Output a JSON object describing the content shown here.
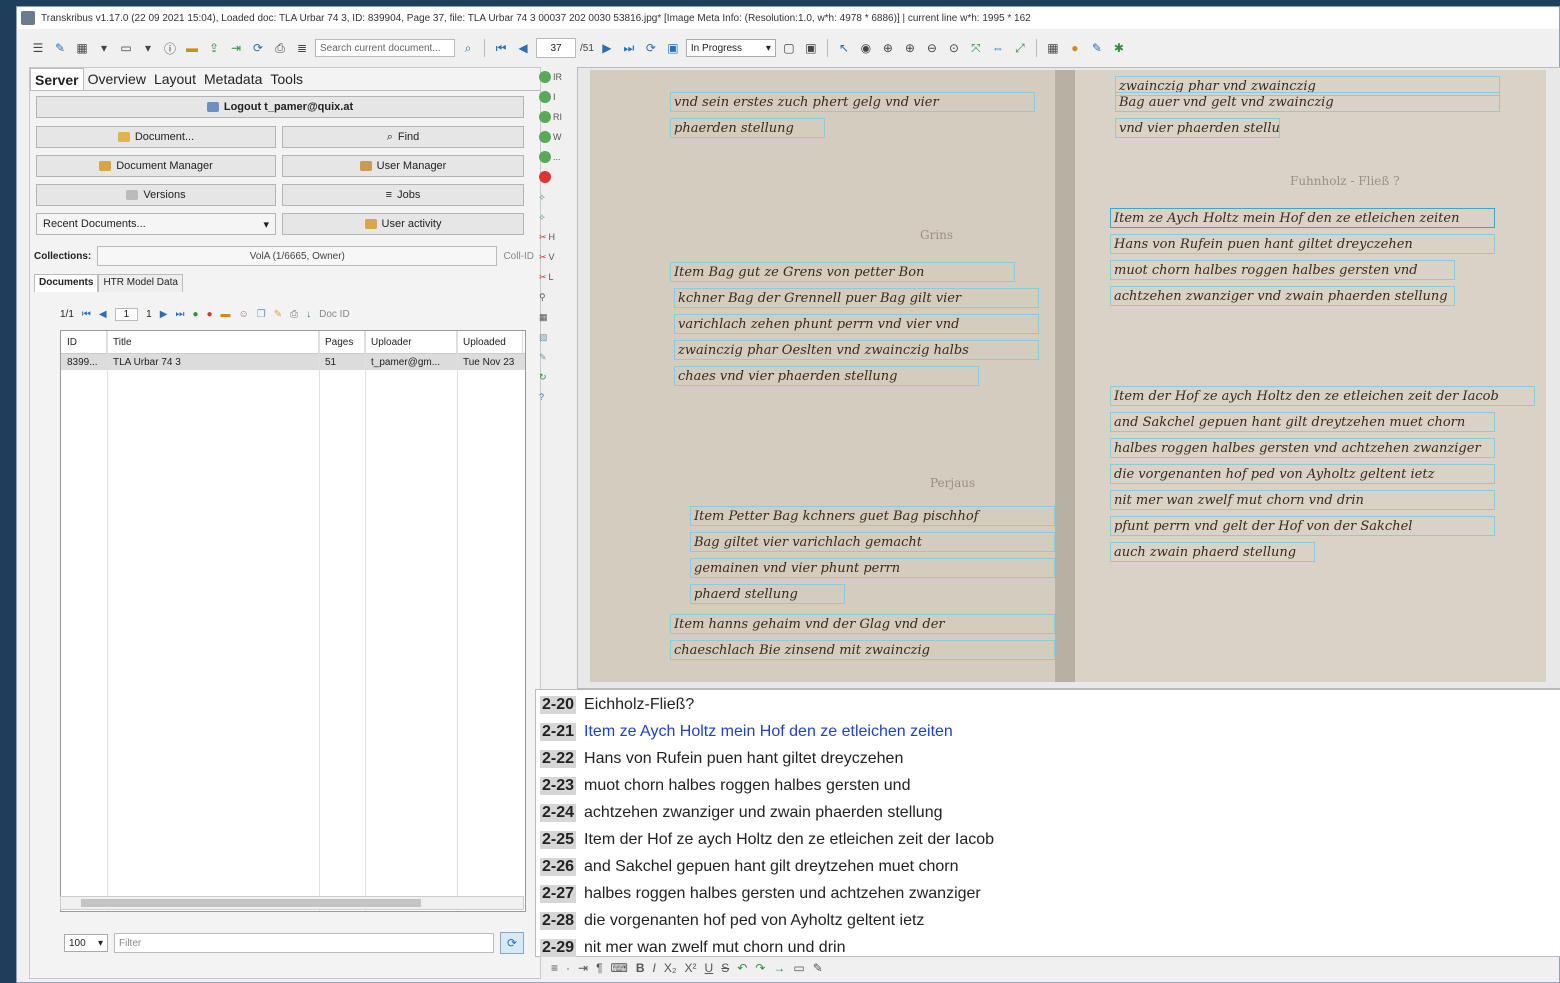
{
  "window_title": "Transkribus v1.17.0 (22 09 2021 15:04), Loaded doc: TLA Urbar 74 3, ID: 839904, Page 37, file: TLA Urbar 74 3 00037 202 0030 53816.jpg* [Image Meta Info: (Resolution:1.0, w*h: 4978 * 6886)] | current line w*h: 1995 * 162",
  "toolbar": {
    "search_placeholder": "Search current document...",
    "page_current": "37",
    "page_total": "/51",
    "status_value": "In Progress"
  },
  "left": {
    "tabs": [
      "Server",
      "Overview",
      "Layout",
      "Metadata",
      "Tools"
    ],
    "logout_label": "Logout t_pamer@quix.at",
    "buttons": {
      "document": "Document...",
      "find": "Find",
      "doc_manager": "Document Manager",
      "user_manager": "User Manager",
      "versions": "Versions",
      "jobs": "Jobs",
      "recent_docs": "Recent Documents...",
      "user_activity": "User activity"
    },
    "collections_label": "Collections:",
    "collection_value": "VolA (1/6665, Owner)",
    "coll_id": "Coll-ID",
    "subtabs": [
      "Documents",
      "HTR Model Data"
    ],
    "pager": {
      "range": "1/1",
      "page": "1",
      "of": "1",
      "docid_placeholder": "Doc ID"
    },
    "columns": [
      "ID",
      "Title",
      "Pages",
      "Uploader",
      "Uploaded"
    ],
    "rows": [
      {
        "id": "8399...",
        "title": "TLA Urbar 74 3",
        "pages": "51",
        "uploader": "t_pamer@gm...",
        "uploaded": "Tue Nov 23"
      }
    ],
    "page_size": "100",
    "filter_placeholder": "Filter"
  },
  "strip": [
    "IR",
    "I",
    "RI",
    "W",
    "...",
    "",
    "",
    "",
    "H",
    "V",
    "L",
    "",
    "",
    "",
    "",
    "",
    ""
  ],
  "manuscript": {
    "headings": [
      "Grins",
      "Perjaus",
      "Fuhnholz - Fließ ?"
    ],
    "left_lines": [
      "vnd sein erstes zuch phert gelg vnd vier",
      "phaerden stellung",
      "Item Bag gut ze Grens von petter Bon",
      "kchner Bag der Grennell puer Bag gilt vier",
      "varichlach zehen phunt perrn vnd vier vnd",
      "zwainczig phar Oeslten vnd zwainczig halbs",
      "chaes vnd vier phaerden stellung",
      "Item Petter Bag kchners guet Bag pischhof",
      "Bag giltet vier varichlach gemacht",
      "gemainen vnd vier phunt perrn",
      "phaerd stellung",
      "Item hanns gehaim vnd der Glag vnd der",
      "chaeschlach Bie zinsend mit zwainczig"
    ],
    "right_lines": [
      "zwainczig phar vnd zwainczig",
      "Bag auer vnd gelt vnd zwainczig",
      "vnd vier phaerden stellung",
      "Item ze Aych Holtz mein Hof den ze etleichen zeiten",
      "Hans von Rufein puen hant giltet dreyczehen",
      "muot chorn halbes roggen halbes gersten vnd",
      "achtzehen zwanziger vnd zwain phaerden stellung",
      "Item der Hof ze aych Holtz den ze etleichen zeit der Iacob",
      "and Sakchel gepuen hant gilt dreytzehen muet chorn",
      "halbes roggen halbes gersten vnd achtzehen zwanziger",
      "die vorgenanten hof ped von Ayholtz geltent ietz",
      "nit mer wan zwelf mut chorn vnd drin",
      "pfunt perrn vnd gelt der Hof von der Sakchel",
      "auch zwain phaerd stellung"
    ]
  },
  "transcription": [
    {
      "num": "2-20",
      "text": "Eichholz-Fließ?"
    },
    {
      "num": "2-21",
      "text": "Item ze Aych Holtz mein Hof den ze etleichen zeiten",
      "current": true
    },
    {
      "num": "2-22",
      "text": "Hans von Rufein puen hant giltet dreyczehen"
    },
    {
      "num": "2-23",
      "text": "muot chorn halbes roggen halbes gersten und"
    },
    {
      "num": "2-24",
      "text": "achtzehen zwanziger und zwain phaerden stellung"
    },
    {
      "num": "2-25",
      "text": "Item der Hof ze aych Holtz den ze etleichen zeit der Iacob"
    },
    {
      "num": "2-26",
      "text": "and Sakchel gepuen hant gilt dreytzehen muet chorn"
    },
    {
      "num": "2-27",
      "text": "halbes roggen halbes gersten und achtzehen zwanziger"
    },
    {
      "num": "2-28",
      "text": "die vorgenanten hof ped von Ayholtz geltent ietz"
    },
    {
      "num": "2-29",
      "text": "nit mer wan zwelf mut chorn und drin"
    }
  ],
  "colors": {
    "accent": "#2140c8",
    "line_box": "#8ec9dc",
    "desktop": "#1d3f5c"
  }
}
